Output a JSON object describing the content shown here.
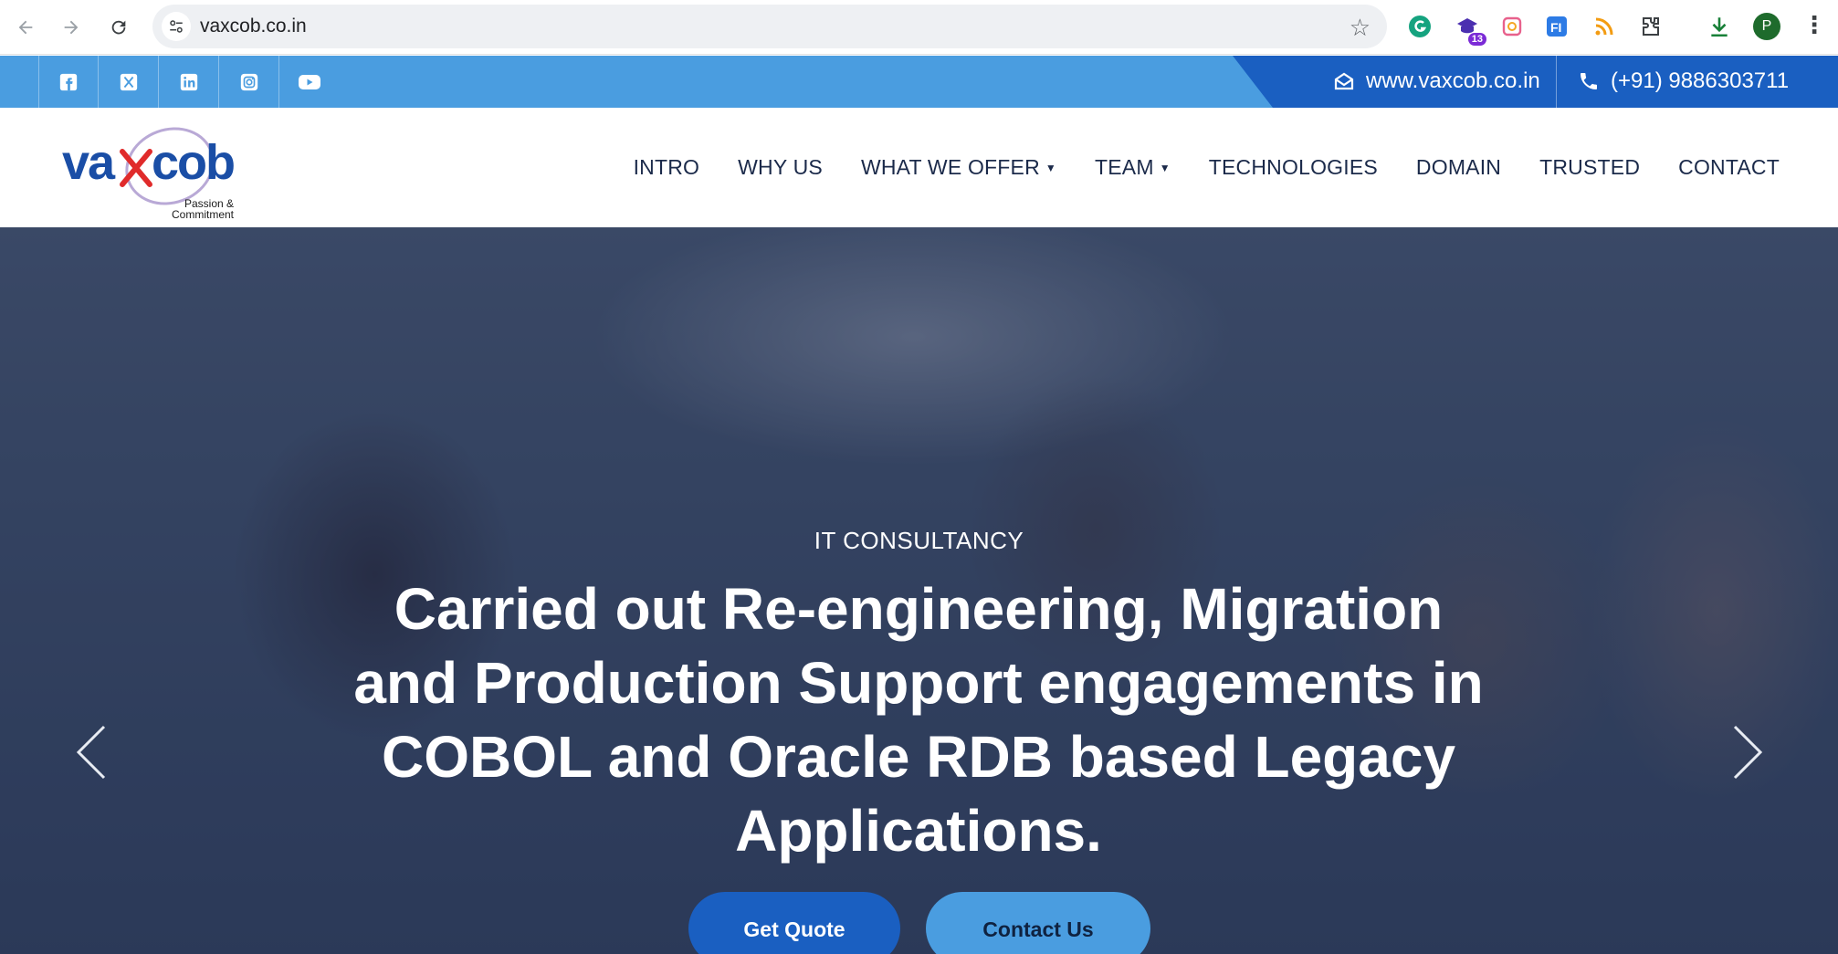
{
  "browser": {
    "url": "vaxcob.co.in",
    "extension_badge": "13",
    "profile_initial": "P"
  },
  "topbar": {
    "socials": [
      "facebook-icon",
      "x-twitter-icon",
      "linkedin-icon",
      "instagram-icon",
      "youtube-icon"
    ],
    "email": "www.vaxcob.co.in",
    "phone": "(+91) 9886303711"
  },
  "header": {
    "logo_tagline_1": "Passion &",
    "logo_tagline_2": "Commitment",
    "menu": [
      {
        "label": "INTRO"
      },
      {
        "label": "WHY US"
      },
      {
        "label": "WHAT WE OFFER"
      },
      {
        "label": "TEAM"
      },
      {
        "label": "TECHNOLOGIES"
      },
      {
        "label": "DOMAIN"
      },
      {
        "label": "TRUSTED"
      },
      {
        "label": "CONTACT"
      }
    ]
  },
  "hero": {
    "eyebrow": "IT CONSULTANCY",
    "headline": "Carried out Re-engineering, Migration and Production Support engagements in COBOL and Oracle RDB based Legacy Applications.",
    "primary_button": "Get Quote",
    "secondary_button": "Contact Us"
  },
  "colors": {
    "topbar": "#4a9de0",
    "contact_band": "#1a5fc1",
    "menu_text": "#1b2a4a"
  }
}
